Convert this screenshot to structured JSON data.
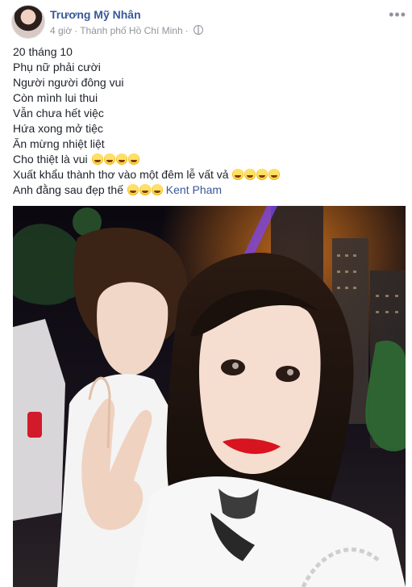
{
  "post": {
    "author": "Trương Mỹ Nhân",
    "time": "4 giờ",
    "location": "Thành phố Hồ Chí Minh",
    "more_label": "•••",
    "lines": [
      "20 tháng 10",
      "Phụ nữ phải cười",
      "Người người đông vui",
      "Còn mình lui thui",
      "Vẫn chưa hết việc",
      "Hứa xong mở tiệc",
      "Ăn mừng nhiệt liệt"
    ],
    "line_emoji_1": "Cho thiệt là vui",
    "line_emoji_2": "Xuất khẩu thành thơ vào một đêm lễ vất vả",
    "line_mention_prefix": "Anh đằng sau đẹp thế",
    "mention_name": "Kent Pham"
  },
  "icons": {
    "globe": "globe-icon",
    "more": "more-options-icon",
    "laughing_emoji": "rolling-on-floor-laughing-emoji",
    "hugging_emoji": "hugging-face-emoji"
  },
  "colors": {
    "author_link": "#385898",
    "meta_text": "#90949c",
    "body_text": "#1d2129"
  }
}
